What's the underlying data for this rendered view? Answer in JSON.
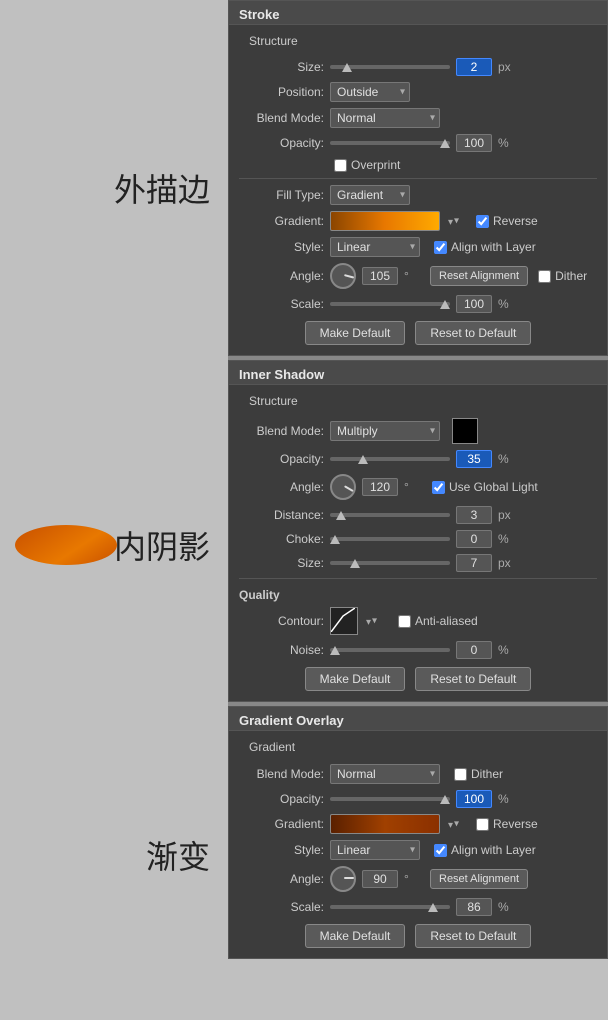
{
  "stroke_panel": {
    "title": "Stroke",
    "structure_label": "Structure",
    "size_label": "Size:",
    "size_value": "2",
    "size_unit": "px",
    "position_label": "Position:",
    "position_value": "Outside",
    "blend_mode_label": "Blend Mode:",
    "blend_mode_value": "Normal",
    "opacity_label": "Opacity:",
    "opacity_value": "100",
    "opacity_unit": "%",
    "overprint_label": "Overprint",
    "fill_type_label": "Fill Type:",
    "fill_type_value": "Gradient",
    "gradient_label": "Gradient:",
    "reverse_label": "Reverse",
    "style_label": "Style:",
    "style_value": "Linear",
    "align_layer_label": "Align with Layer",
    "angle_label": "Angle:",
    "angle_value": "105",
    "angle_unit": "°",
    "reset_alignment_btn": "Reset Alignment",
    "dither_label": "Dither",
    "scale_label": "Scale:",
    "scale_value": "100",
    "scale_unit": "%",
    "make_default_btn": "Make Default",
    "reset_default_btn": "Reset to Default"
  },
  "inner_shadow_panel": {
    "title": "Inner Shadow",
    "structure_label": "Structure",
    "blend_mode_label": "Blend Mode:",
    "blend_mode_value": "Multiply",
    "opacity_label": "Opacity:",
    "opacity_value": "35",
    "opacity_unit": "%",
    "angle_label": "Angle:",
    "angle_value": "120",
    "angle_unit": "°",
    "use_global_light_label": "Use Global Light",
    "distance_label": "Distance:",
    "distance_value": "3",
    "distance_unit": "px",
    "choke_label": "Choke:",
    "choke_value": "0",
    "choke_unit": "%",
    "size_label": "Size:",
    "size_value": "7",
    "size_unit": "px",
    "quality_label": "Quality",
    "contour_label": "Contour:",
    "anti_aliased_label": "Anti-aliased",
    "noise_label": "Noise:",
    "noise_value": "0",
    "noise_unit": "%",
    "make_default_btn": "Make Default",
    "reset_default_btn": "Reset to Default"
  },
  "gradient_overlay_panel": {
    "title": "Gradient Overlay",
    "gradient_sublabel": "Gradient",
    "blend_mode_label": "Blend Mode:",
    "blend_mode_value": "Normal",
    "dither_label": "Dither",
    "opacity_label": "Opacity:",
    "opacity_value": "100",
    "opacity_unit": "%",
    "gradient_label": "Gradient:",
    "reverse_label": "Reverse",
    "style_label": "Style:",
    "style_value": "Linear",
    "align_layer_label": "Align with Layer",
    "angle_label": "Angle:",
    "angle_value": "90",
    "angle_unit": "°",
    "reset_alignment_btn": "Reset Alignment",
    "scale_label": "Scale:",
    "scale_value": "86",
    "scale_unit": "%",
    "make_default_btn": "Make Default",
    "reset_default_btn": "Reset to Default"
  },
  "left_labels": {
    "stroke": "外描边",
    "shadow": "内阴影",
    "gradient": "渐变"
  }
}
